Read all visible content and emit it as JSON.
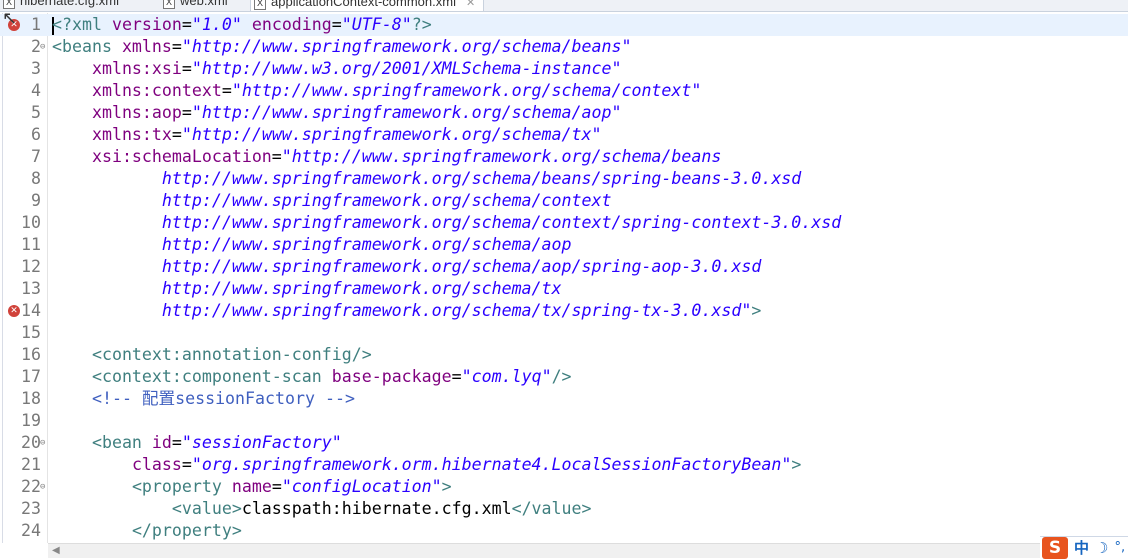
{
  "tabs": [
    {
      "label": "hibernate.cfg.xml",
      "active": false
    },
    {
      "label": "web.xml",
      "active": false
    },
    {
      "label": "applicationContext-common.xml",
      "active": true
    }
  ],
  "tab_close_icon": "close-icon",
  "current_line": 1,
  "lines": [
    {
      "n": "1",
      "err": true,
      "tokens": [
        [
          "pi",
          "<?"
        ],
        [
          "tag",
          "xml "
        ],
        [
          "attr",
          "version"
        ],
        [
          "txt",
          "="
        ],
        [
          "val",
          "\"1.0\""
        ],
        [
          "txt",
          " "
        ],
        [
          "attr",
          "encoding"
        ],
        [
          "txt",
          "="
        ],
        [
          "val",
          "\"UTF-8\""
        ],
        [
          "pi",
          "?>"
        ]
      ]
    },
    {
      "n": "2",
      "fold": true,
      "tokens": [
        [
          "tag",
          "<beans "
        ],
        [
          "attr",
          "xmlns"
        ],
        [
          "txt",
          "="
        ],
        [
          "val",
          "\"http://www.springframework.org/schema/beans\""
        ]
      ]
    },
    {
      "n": "3",
      "tokens": [
        [
          "txt",
          "    "
        ],
        [
          "attr",
          "xmlns:xsi"
        ],
        [
          "txt",
          "="
        ],
        [
          "val",
          "\"http://www.w3.org/2001/XMLSchema-instance\""
        ]
      ]
    },
    {
      "n": "4",
      "tokens": [
        [
          "txt",
          "    "
        ],
        [
          "attr",
          "xmlns:context"
        ],
        [
          "txt",
          "="
        ],
        [
          "val",
          "\"http://www.springframework.org/schema/context\""
        ]
      ]
    },
    {
      "n": "5",
      "tokens": [
        [
          "txt",
          "    "
        ],
        [
          "attr",
          "xmlns:aop"
        ],
        [
          "txt",
          "="
        ],
        [
          "val",
          "\"http://www.springframework.org/schema/aop\""
        ]
      ]
    },
    {
      "n": "6",
      "tokens": [
        [
          "txt",
          "    "
        ],
        [
          "attr",
          "xmlns:tx"
        ],
        [
          "txt",
          "="
        ],
        [
          "val",
          "\"http://www.springframework.org/schema/tx\""
        ]
      ]
    },
    {
      "n": "7",
      "tokens": [
        [
          "txt",
          "    "
        ],
        [
          "attr",
          "xsi:schemaLocation"
        ],
        [
          "txt",
          "="
        ],
        [
          "val",
          "\"http://www.springframework.org/schema/beans"
        ]
      ]
    },
    {
      "n": "8",
      "tokens": [
        [
          "txt",
          "           "
        ],
        [
          "val",
          "http://www.springframework.org/schema/beans/spring-beans-3.0.xsd"
        ]
      ]
    },
    {
      "n": "9",
      "tokens": [
        [
          "txt",
          "           "
        ],
        [
          "val",
          "http://www.springframework.org/schema/context"
        ]
      ]
    },
    {
      "n": "10",
      "tokens": [
        [
          "txt",
          "           "
        ],
        [
          "val",
          "http://www.springframework.org/schema/context/spring-context-3.0.xsd"
        ]
      ]
    },
    {
      "n": "11",
      "tokens": [
        [
          "txt",
          "           "
        ],
        [
          "val",
          "http://www.springframework.org/schema/aop"
        ]
      ]
    },
    {
      "n": "12",
      "tokens": [
        [
          "txt",
          "           "
        ],
        [
          "val",
          "http://www.springframework.org/schema/aop/spring-aop-3.0.xsd"
        ]
      ]
    },
    {
      "n": "13",
      "tokens": [
        [
          "txt",
          "           "
        ],
        [
          "val",
          "http://www.springframework.org/schema/tx"
        ]
      ]
    },
    {
      "n": "14",
      "err": true,
      "tokens": [
        [
          "txt",
          "           "
        ],
        [
          "val",
          "http://www.springframework.org/schema/tx/spring-tx-3.0.xsd\""
        ],
        [
          "tag",
          ">"
        ]
      ]
    },
    {
      "n": "15",
      "tokens": []
    },
    {
      "n": "16",
      "tokens": [
        [
          "txt",
          "    "
        ],
        [
          "tag",
          "<context:annotation-config/>"
        ]
      ]
    },
    {
      "n": "17",
      "tokens": [
        [
          "txt",
          "    "
        ],
        [
          "tag",
          "<context:component-scan "
        ],
        [
          "attr",
          "base-package"
        ],
        [
          "txt",
          "="
        ],
        [
          "val",
          "\"com.lyq\""
        ],
        [
          "tag",
          "/>"
        ]
      ]
    },
    {
      "n": "18",
      "tokens": [
        [
          "txt",
          "    "
        ],
        [
          "cmt",
          "<!-- 配置sessionFactory -->"
        ]
      ]
    },
    {
      "n": "19",
      "tokens": []
    },
    {
      "n": "20",
      "fold": true,
      "tokens": [
        [
          "txt",
          "    "
        ],
        [
          "tag",
          "<bean "
        ],
        [
          "attr",
          "id"
        ],
        [
          "txt",
          "="
        ],
        [
          "val",
          "\"sessionFactory\""
        ]
      ]
    },
    {
      "n": "21",
      "tokens": [
        [
          "txt",
          "        "
        ],
        [
          "attr",
          "class"
        ],
        [
          "txt",
          "="
        ],
        [
          "val",
          "\"org.springframework.orm.hibernate4.LocalSessionFactoryBean\""
        ],
        [
          "tag",
          ">"
        ]
      ]
    },
    {
      "n": "22",
      "fold": true,
      "tokens": [
        [
          "txt",
          "        "
        ],
        [
          "tag",
          "<property "
        ],
        [
          "attr",
          "name"
        ],
        [
          "txt",
          "="
        ],
        [
          "val",
          "\"configLocation\""
        ],
        [
          "tag",
          ">"
        ]
      ]
    },
    {
      "n": "23",
      "tokens": [
        [
          "txt",
          "            "
        ],
        [
          "tag",
          "<value>"
        ],
        [
          "txt",
          "classpath:hibernate.cfg.xml"
        ],
        [
          "tag",
          "</value>"
        ]
      ]
    },
    {
      "n": "24",
      "tokens": [
        [
          "txt",
          "        "
        ],
        [
          "tag",
          "</property>"
        ]
      ]
    }
  ],
  "ime": {
    "logo": "S",
    "mode": "中",
    "moon": "☽",
    "punct": "°,"
  },
  "colors": {
    "tag": "#3f7f7f",
    "attr": "#7f007f",
    "value": "#2a00ff",
    "comment": "#3f5fbf",
    "current_line": "#e8f2fe"
  }
}
